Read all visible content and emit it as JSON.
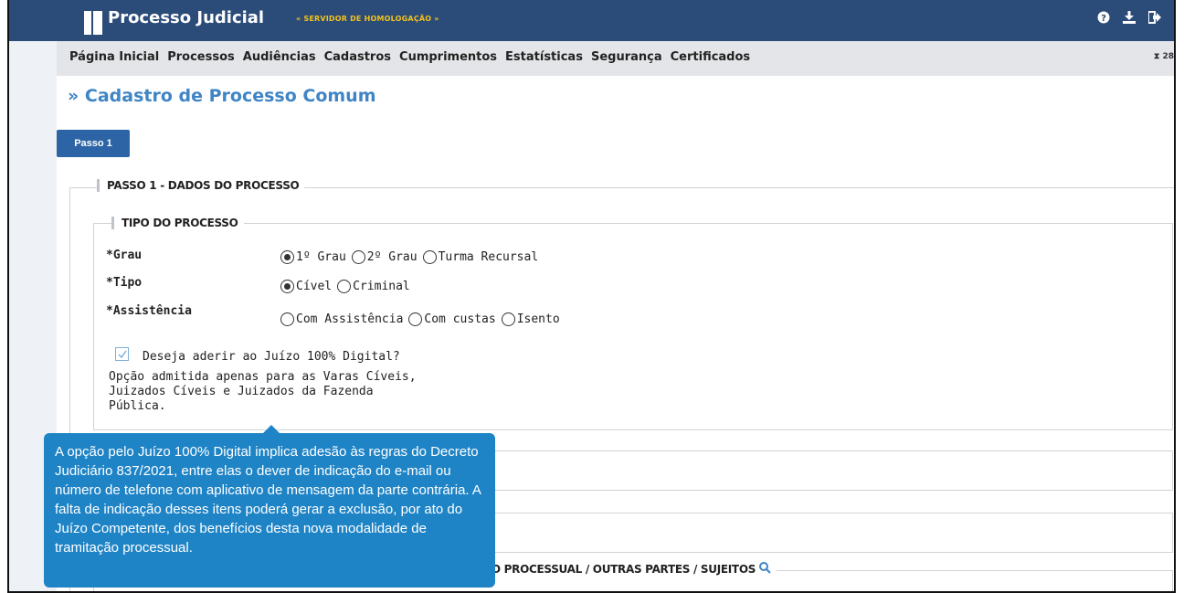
{
  "header": {
    "app_title": "Processo Judicial",
    "environment_label": "« SERVIDOR DE HOMOLOGAÇÃO »",
    "icons": [
      "help-icon",
      "download-icon",
      "logout-icon"
    ]
  },
  "menu": {
    "items": [
      "Página Inicial",
      "Processos",
      "Audiências",
      "Cadastros",
      "Cumprimentos",
      "Estatísticas",
      "Segurança",
      "Certificados"
    ],
    "timer": "⧗ 28"
  },
  "page": {
    "title": "» Cadastro de Processo Comum",
    "step_button": "Passo 1"
  },
  "step1": {
    "legend": "PASSO 1 - DADOS DO PROCESSO",
    "tipo_legend": "TIPO DO PROCESSO",
    "grau": {
      "label": "*Grau",
      "options": [
        "1º Grau",
        "2º Grau",
        "Turma Recursal"
      ],
      "selected": "1º Grau"
    },
    "tipo": {
      "label": "*Tipo",
      "options": [
        "Cível",
        "Criminal"
      ],
      "selected": "Cível"
    },
    "assistencia": {
      "label": "*Assistência",
      "options": [
        "Com Assistência",
        "Com custas",
        "Isento"
      ],
      "selected": ""
    },
    "juizo_digital": {
      "checked": true,
      "label": "Deseja aderir ao Juízo 100% Digital?",
      "note": "Opção admitida apenas para as Varas Cíveis, Juizados Cíveis e Juizados da Fazenda Pública."
    },
    "partes_legend": "TO PROCESSUAL / OUTRAS PARTES / SUJEITOS"
  },
  "tooltip": {
    "text": "A opção pelo Juízo 100% Digital implica adesão às regras do Decreto Judiciário 837/2021, entre elas o dever de indicação do e-mail ou número de telefone com aplicativo de mensagem da parte contrária. A falta de indicação desses itens poderá gerar a exclusão, por ato do Juízo Competente, dos benefícios desta nova modalidade de tramitação processual."
  },
  "colors": {
    "header_bg": "#2b4b79",
    "accent": "#3f84c5",
    "tooltip_bg": "#1f84c6",
    "env_label": "#f3c21a"
  }
}
